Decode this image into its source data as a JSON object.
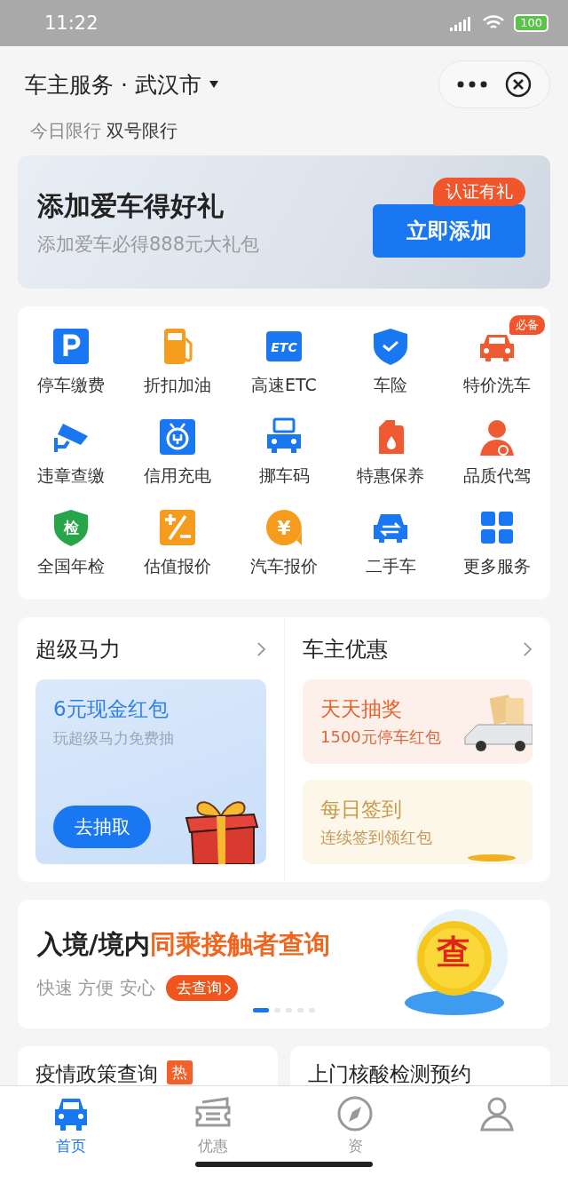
{
  "status_bar": {
    "time": "11:22",
    "battery": "100"
  },
  "header": {
    "title": "车主服务 · 武汉市",
    "restriction_label": "今日限行",
    "restriction_value": "双号限行"
  },
  "add_car_banner": {
    "title": "添加爱车得好礼",
    "subtitle": "添加爱车必得888元大礼包",
    "button": "立即添加",
    "badge": "认证有礼"
  },
  "services": [
    {
      "label": "停车缴费",
      "kind": "parking"
    },
    {
      "label": "折扣加油",
      "kind": "fuel"
    },
    {
      "label": "高速ETC",
      "kind": "etc",
      "icon_text": "ETC"
    },
    {
      "label": "车险",
      "kind": "shield"
    },
    {
      "label": "特价洗车",
      "kind": "car",
      "badge": "必备"
    },
    {
      "label": "违章查缴",
      "kind": "camera"
    },
    {
      "label": "信用充电",
      "kind": "plug"
    },
    {
      "label": "挪车码",
      "kind": "qrcar"
    },
    {
      "label": "特惠保养",
      "kind": "oil"
    },
    {
      "label": "品质代驾",
      "kind": "driver"
    },
    {
      "label": "全国年检",
      "kind": "inspect",
      "icon_text": "检"
    },
    {
      "label": "估值报价",
      "kind": "calc"
    },
    {
      "label": "汽车报价",
      "kind": "yuan",
      "icon_text": "¥"
    },
    {
      "label": "二手车",
      "kind": "swapcar"
    },
    {
      "label": "更多服务",
      "kind": "grid"
    }
  ],
  "super_power": {
    "heading": "超级马力",
    "card_title": "6元现金红包",
    "card_subtitle": "玩超级马力免费抽",
    "button": "去抽取"
  },
  "owner_deals": {
    "heading": "车主优惠",
    "cards": [
      {
        "kind": "lottery",
        "title": "天天抽奖",
        "subtitle": "1500元停车红包"
      },
      {
        "kind": "checkin",
        "title": "每日签到",
        "subtitle": "连续签到领红包"
      }
    ]
  },
  "promo": {
    "title_lead": "入境/境内",
    "title_highlight": "同乘接触者查询",
    "tagline": "快速 方便 安心",
    "button": "去查询",
    "coin_text": "查",
    "dots": [
      {
        "selected": true
      },
      {
        "selected": false
      },
      {
        "selected": false
      },
      {
        "selected": false
      },
      {
        "selected": false
      }
    ]
  },
  "more_cards": [
    {
      "title": "疫情政策查询",
      "badge": "热"
    },
    {
      "title": "上门核酸检测预约"
    }
  ],
  "tab_bar": [
    {
      "label": "首页",
      "kind": "car",
      "selected": true
    },
    {
      "label": "优惠",
      "kind": "ticket",
      "selected": false
    },
    {
      "label": "资",
      "kind": "compass",
      "selected": false
    },
    {
      "kind": "person",
      "selected": false
    }
  ]
}
